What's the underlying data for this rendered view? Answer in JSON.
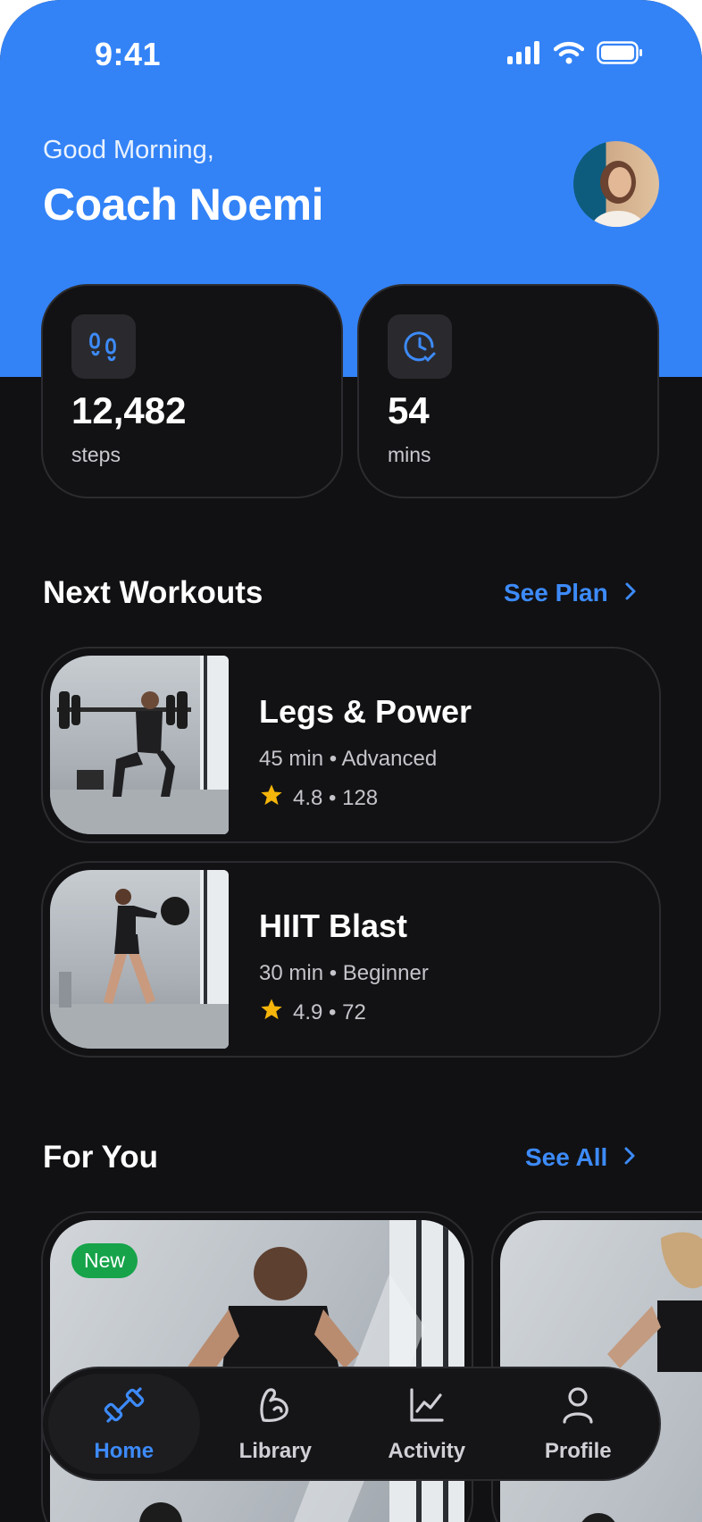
{
  "status_bar": {
    "time": "9:41"
  },
  "header": {
    "greeting": "Good Morning,",
    "name": "Coach Noemi"
  },
  "stats": [
    {
      "value": "12,482",
      "unit": "steps",
      "icon": "footsteps-icon"
    },
    {
      "value": "54",
      "unit": "mins",
      "icon": "clock-check-icon"
    }
  ],
  "next_workouts": {
    "title": "Next Workouts",
    "link": "See Plan",
    "items": [
      {
        "title": "Legs & Power",
        "meta": "45 min • Advanced",
        "rating": "4.8 • 128"
      },
      {
        "title": "HIIT Blast",
        "meta": "30 min • Beginner",
        "rating": "4.9 • 72"
      }
    ]
  },
  "for_you": {
    "title": "For You",
    "link": "See All",
    "cards": [
      {
        "badge": "New"
      }
    ]
  },
  "tabs": [
    {
      "label": "Home",
      "icon": "dumbbell-icon",
      "active": true
    },
    {
      "label": "Library",
      "icon": "bicep-icon",
      "active": false
    },
    {
      "label": "Activity",
      "icon": "chart-line-icon",
      "active": false
    },
    {
      "label": "Profile",
      "icon": "user-icon",
      "active": false
    }
  ],
  "colors": {
    "accent": "#3383f7",
    "link": "#3d8bfa",
    "background": "#111113",
    "badge": "#16a34a",
    "star": "#f5b50a"
  }
}
